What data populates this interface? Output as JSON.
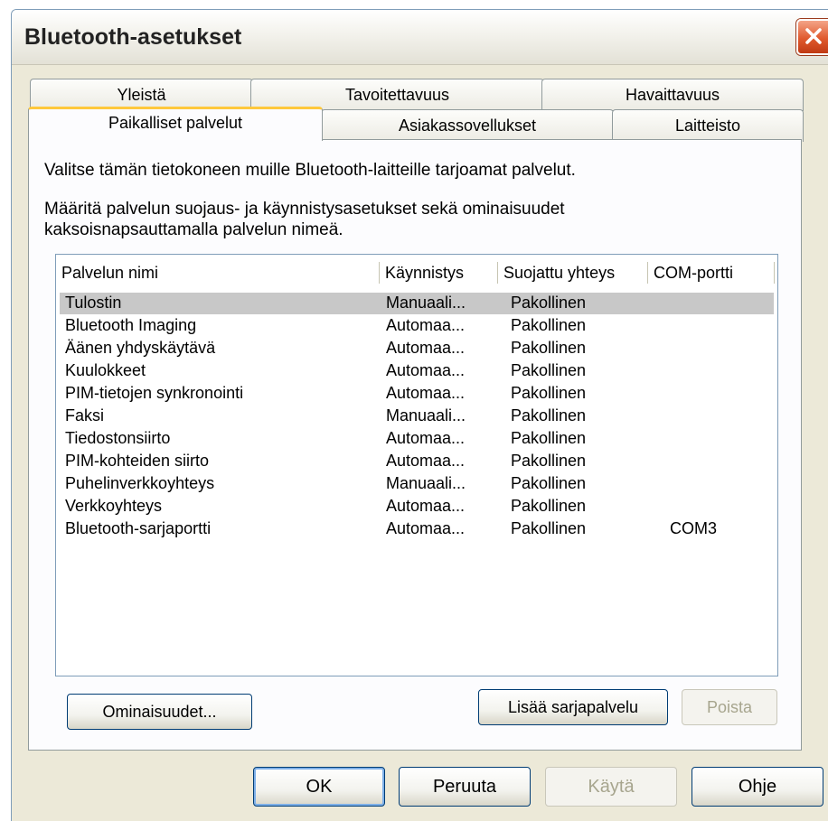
{
  "window": {
    "title": "Bluetooth-asetukset",
    "close_icon": "close-icon"
  },
  "tabs": {
    "row1": [
      "Yleistä",
      "Tavoitettavuus",
      "Havaittavuus"
    ],
    "row2": [
      "Paikalliset palvelut",
      "Asiakassovellukset",
      "Laitteisto"
    ],
    "active": "Paikalliset palvelut"
  },
  "panel": {
    "desc1": "Valitse tämän tietokoneen muille Bluetooth-laitteille tarjoamat palvelut.",
    "desc2_line1": "Määritä palvelun suojaus- ja käynnistysasetukset sekä ominaisuudet",
    "desc2_line2": "kaksoisnapsauttamalla palvelun nimeä."
  },
  "list": {
    "columns": [
      "Palvelun nimi",
      "Käynnistys",
      "Suojattu yhteys",
      "COM-portti"
    ],
    "rows": [
      {
        "name": "Tulostin",
        "startup": "Manuaali...",
        "secure": "Pakollinen",
        "com": ""
      },
      {
        "name": "Bluetooth Imaging",
        "startup": "Automaa...",
        "secure": "Pakollinen",
        "com": ""
      },
      {
        "name": "Äänen yhdyskäytävä",
        "startup": "Automaa...",
        "secure": "Pakollinen",
        "com": ""
      },
      {
        "name": "Kuulokkeet",
        "startup": "Automaa...",
        "secure": "Pakollinen",
        "com": ""
      },
      {
        "name": "PIM-tietojen synkronointi",
        "startup": "Automaa...",
        "secure": "Pakollinen",
        "com": ""
      },
      {
        "name": "Faksi",
        "startup": "Manuaali...",
        "secure": "Pakollinen",
        "com": ""
      },
      {
        "name": "Tiedostonsiirto",
        "startup": "Automaa...",
        "secure": "Pakollinen",
        "com": ""
      },
      {
        "name": "PIM-kohteiden siirto",
        "startup": "Automaa...",
        "secure": "Pakollinen",
        "com": ""
      },
      {
        "name": "Puhelinverkkoyhteys",
        "startup": "Manuaali...",
        "secure": "Pakollinen",
        "com": ""
      },
      {
        "name": "Verkkoyhteys",
        "startup": "Automaa...",
        "secure": "Pakollinen",
        "com": ""
      },
      {
        "name": "Bluetooth-sarjaportti",
        "startup": "Automaa...",
        "secure": "Pakollinen",
        "com": "COM3"
      }
    ],
    "selected_index": 0
  },
  "panel_buttons": {
    "properties": "Ominaisuudet...",
    "add_serial": "Lisää sarjapalvelu",
    "remove": "Poista"
  },
  "dialog_buttons": {
    "ok": "OK",
    "cancel": "Peruuta",
    "apply": "Käytä",
    "help": "Ohje"
  }
}
